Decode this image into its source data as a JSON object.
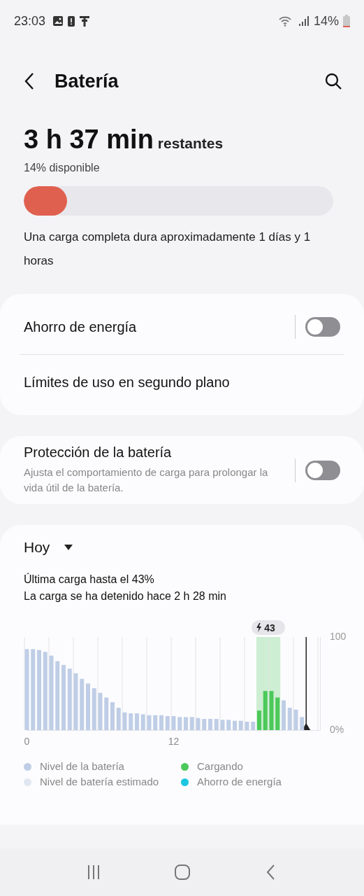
{
  "status_bar": {
    "time": "23:03",
    "battery": "14%"
  },
  "header": {
    "title": "Batería"
  },
  "summary": {
    "time_left": "3 h 37 min",
    "suffix": "restantes",
    "available": "14% disponible",
    "level": 0.14,
    "note": "Una carga completa dura aproximadamente 1 días y 1 horas"
  },
  "card_1": [
    {
      "label": "Ahorro de energía",
      "kind": "toggle",
      "on": false
    },
    {
      "label": "Límites de uso en segundo plano",
      "kind": "link"
    }
  ],
  "card_2": [
    {
      "label": "Protección de la batería",
      "subtitle": "Ajusta el comportamiento de carga para prolongar la vida útil de la batería.",
      "kind": "toggle",
      "on": false
    }
  ],
  "usage": {
    "period": "Hoy",
    "last_charge": "Última carga hasta el 43%",
    "stopped": "La carga se ha detenido hace 2 h 28 min",
    "chart_data": {
      "type": "bar",
      "xlim": [
        0,
        24
      ],
      "ylim": [
        0,
        100
      ],
      "xticks": [
        0,
        12
      ],
      "yticks": [
        {
          "value": 0,
          "label": "0%"
        },
        {
          "value": 100,
          "label": "100"
        }
      ],
      "x": [
        0,
        0.5,
        1,
        1.5,
        2,
        2.5,
        3,
        3.5,
        4,
        4.5,
        5,
        5.5,
        6,
        6.5,
        7,
        7.5,
        8,
        8.5,
        9,
        9.5,
        10,
        10.5,
        11,
        11.5,
        12,
        12.5,
        13,
        13.5,
        14,
        14.5,
        15,
        15.5,
        16,
        16.5,
        17,
        17.5,
        18,
        18.5,
        19,
        19.5,
        20,
        20.5,
        21,
        21.5,
        22,
        22.5
      ],
      "series": [
        {
          "name": "Nivel de la batería",
          "color": "#bfcee6",
          "values": [
            87,
            87,
            86,
            84,
            80,
            74,
            70,
            66,
            61,
            55,
            50,
            45,
            40,
            35,
            30,
            24,
            19,
            18,
            18,
            17,
            16,
            16,
            16,
            15,
            15,
            14,
            14,
            14,
            13,
            12,
            12,
            12,
            11,
            11,
            10,
            10,
            9,
            9,
            null,
            null,
            null,
            null,
            32,
            24,
            22,
            14
          ]
        },
        {
          "name": "Cargando",
          "color": "#4cc95a",
          "values": [
            null,
            null,
            null,
            null,
            null,
            null,
            null,
            null,
            null,
            null,
            null,
            null,
            null,
            null,
            null,
            null,
            null,
            null,
            null,
            null,
            null,
            null,
            null,
            null,
            null,
            null,
            null,
            null,
            null,
            null,
            null,
            null,
            null,
            null,
            null,
            null,
            null,
            null,
            21,
            42,
            42,
            35,
            null,
            null,
            null,
            null
          ]
        }
      ],
      "annotations": [
        "43"
      ]
    },
    "legend": [
      {
        "label": "Nivel de batería estimado",
        "color": "#e1e7f1"
      },
      {
        "label": "Ahorro de energía",
        "color": "#1cc6e0"
      }
    ]
  }
}
